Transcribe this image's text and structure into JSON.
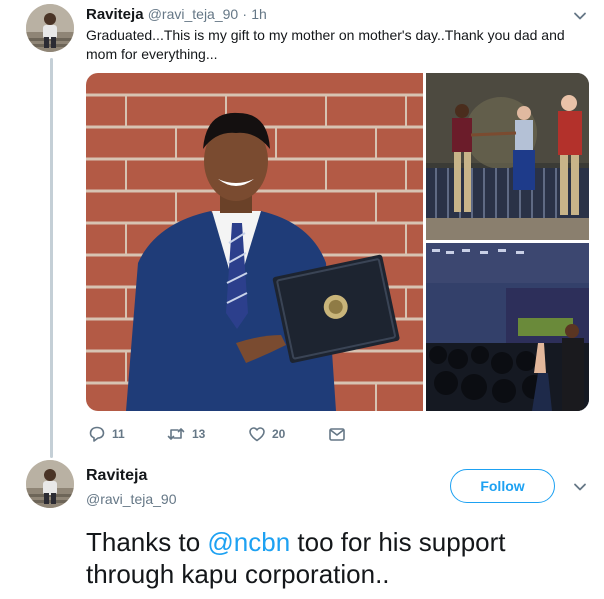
{
  "tweet1": {
    "display_name": "Raviteja",
    "handle": "@ravi_teja_90",
    "separator": "·",
    "time": "1h",
    "text": "Graduated...This is my gift to my mother on mother's day..Thank you dad and mom for everything...",
    "avatar_icon": "profile-photo",
    "media": [
      {
        "name": "graduate-holding-diploma-photo"
      },
      {
        "name": "stage-handshake-photo"
      },
      {
        "name": "graduation-ceremony-crowd-photo"
      }
    ],
    "actions": {
      "reply_count": "11",
      "retweet_count": "13",
      "like_count": "20"
    }
  },
  "tweet2": {
    "display_name": "Raviteja",
    "handle": "@ravi_teja_90",
    "follow_label": "Follow",
    "text_before": "Thanks to ",
    "mention": "@ncbn",
    "text_after": " too for his support through kapu corporation..",
    "avatar_icon": "profile-photo"
  },
  "colors": {
    "accent": "#1da1f2",
    "secondary_text": "#657786",
    "primary_text": "#14171a",
    "thread_line": "#c4cfd6"
  }
}
